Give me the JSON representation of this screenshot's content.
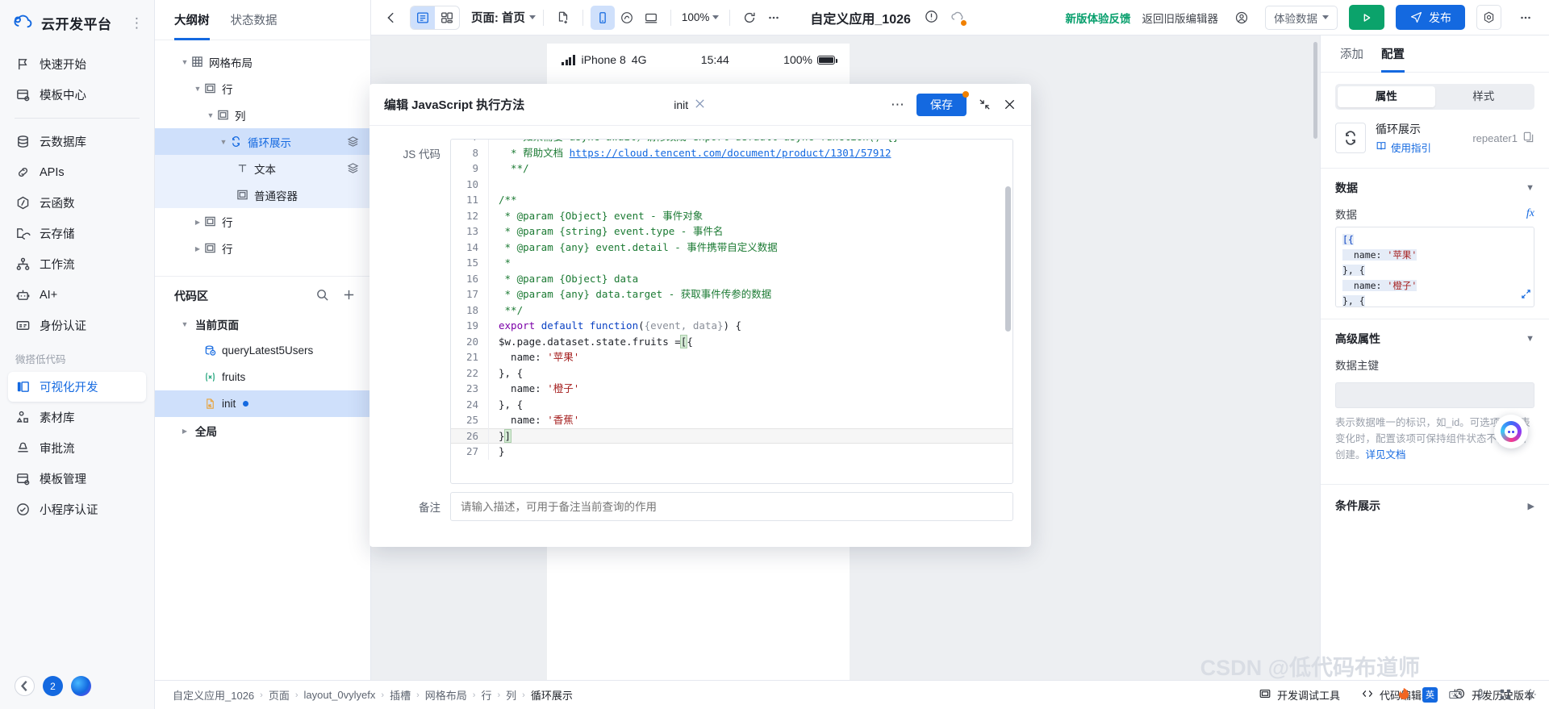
{
  "brand": {
    "name": "云开发平台",
    "logo_icon": "cloud-logo-icon",
    "more_icon": "more-vertical-icon"
  },
  "sidebar": {
    "items": [
      {
        "label": "快速开始",
        "icon": "flag-icon"
      },
      {
        "label": "模板中心",
        "icon": "template-icon"
      },
      {
        "label": "云数据库",
        "icon": "database-icon"
      },
      {
        "label": "APIs",
        "icon": "link-icon"
      },
      {
        "label": "云函数",
        "icon": "function-icon"
      },
      {
        "label": "云存储",
        "icon": "storage-icon"
      },
      {
        "label": "工作流",
        "icon": "workflow-icon"
      },
      {
        "label": "AI+",
        "icon": "robot-icon"
      },
      {
        "label": "身份认证",
        "icon": "id-card-icon"
      }
    ],
    "group_title": "微搭低代码",
    "lowcode_items": [
      {
        "label": "可视化开发",
        "icon": "layout-icon",
        "active": true
      },
      {
        "label": "素材库",
        "icon": "assets-icon",
        "active": false
      },
      {
        "label": "审批流",
        "icon": "approval-icon",
        "active": false
      },
      {
        "label": "模板管理",
        "icon": "template-manage-icon",
        "active": false
      },
      {
        "label": "小程序认证",
        "icon": "miniprogram-icon",
        "active": false
      }
    ],
    "collapse_icon": "chevron-left-icon",
    "user_badge": "2",
    "assistant_icon": "assistant-icon"
  },
  "outline": {
    "tabs": [
      {
        "label": "大纲树",
        "active": true
      },
      {
        "label": "状态数据",
        "active": false
      }
    ],
    "tree": [
      {
        "label": "网格布局",
        "icon": "grid-icon",
        "depth": 0,
        "caret": "open",
        "state": ""
      },
      {
        "label": "行",
        "icon": "box-icon",
        "depth": 1,
        "caret": "open",
        "state": ""
      },
      {
        "label": "列",
        "icon": "box-icon",
        "depth": 2,
        "caret": "open",
        "state": ""
      },
      {
        "label": "循环展示",
        "icon": "repeat-icon",
        "depth": 3,
        "caret": "open",
        "state": "sel",
        "layers": true
      },
      {
        "label": "文本",
        "icon": "text-icon",
        "depth": 4,
        "caret": "",
        "state": "sub",
        "layers": true
      },
      {
        "label": "普通容器",
        "icon": "box-icon",
        "depth": 4,
        "caret": "",
        "state": "sub",
        "layers": false
      },
      {
        "label": "行",
        "icon": "box-icon",
        "depth": 1,
        "caret": "closed",
        "state": ""
      },
      {
        "label": "行",
        "icon": "box-icon",
        "depth": 1,
        "caret": "closed",
        "state": ""
      }
    ],
    "code_section": {
      "title": "代码区",
      "search_icon": "search-icon",
      "add_icon": "plus-icon",
      "groups": [
        {
          "label": "当前页面",
          "caret": "open"
        },
        {
          "label": "全局",
          "caret": "closed"
        }
      ],
      "files": [
        {
          "label": "queryLatest5Users",
          "icon": "datasource-icon",
          "selected": false,
          "modified": false
        },
        {
          "label": "fruits",
          "icon": "variable-icon",
          "selected": false,
          "modified": false
        },
        {
          "label": "init",
          "icon": "js-file-icon",
          "selected": true,
          "modified": true
        }
      ]
    }
  },
  "toolbar": {
    "back_icon": "arrow-left-icon",
    "view_outline_icon": "outline-view-icon",
    "view_grid_icon": "grid-view-icon",
    "page_label": "页面: 首页",
    "new_page_icon": "new-page-icon",
    "device_mobile_icon": "mobile-icon",
    "device_watch_icon": "watch-icon",
    "device_desktop_icon": "desktop-icon",
    "zoom_value": "100%",
    "refresh_icon": "refresh-icon",
    "more_icon": "more-horizontal-icon",
    "app_title": "自定义应用_1026",
    "warning_icon": "warning-circle-icon",
    "cloud_icon": "cloud-sync-icon",
    "feedback_link": "新版体验反馈",
    "old_editor_link": "返回旧版编辑器",
    "account_icon": "account-icon",
    "env_select": "体验数据",
    "preview_icon": "play-icon",
    "publish_label": "发布",
    "publish_icon": "send-icon",
    "settings_icon": "settings-icon",
    "more_right_icon": "more-horizontal-icon"
  },
  "canvas": {
    "phone": {
      "signal_icon": "signal-icon",
      "device": "iPhone 8",
      "network": "4G",
      "time": "15:44",
      "battery": "100%",
      "battery_icon": "battery-icon"
    }
  },
  "modal": {
    "title": "编辑 JavaScript 执行方法",
    "method_name": "init",
    "method_icon": "link-broken-icon",
    "more_icon": "more-horizontal-icon",
    "save_label": "保存",
    "collapse_icon": "minimize-icon",
    "close_icon": "close-icon",
    "js_label": "JS 代码",
    "remark_label": "备注",
    "remark_placeholder": "请输入描述，可用于备注当前查询的作用",
    "code_lines": [
      {
        "n": "7",
        "segs": [
          {
            "t": "  * 如果需要 async-await，请修改成 export default async function() {}",
            "c": "k-green"
          }
        ]
      },
      {
        "n": "8",
        "segs": [
          {
            "t": "  * 帮助文档 ",
            "c": "k-green"
          },
          {
            "t": "https://cloud.tencent.com/document/product/1301/57912",
            "c": "k-link"
          }
        ]
      },
      {
        "n": "9",
        "segs": [
          {
            "t": "  **/",
            "c": "k-green"
          }
        ]
      },
      {
        "n": "10",
        "segs": [
          {
            "t": "",
            "c": ""
          }
        ]
      },
      {
        "n": "11",
        "segs": [
          {
            "t": "/**",
            "c": "k-green"
          }
        ]
      },
      {
        "n": "12",
        "segs": [
          {
            "t": " * @param {Object} event - 事件对象",
            "c": "k-green"
          }
        ]
      },
      {
        "n": "13",
        "segs": [
          {
            "t": " * @param {string} event.type - 事件名",
            "c": "k-green"
          }
        ]
      },
      {
        "n": "14",
        "segs": [
          {
            "t": " * @param {any} event.detail - 事件携带自定义数据",
            "c": "k-green"
          }
        ]
      },
      {
        "n": "15",
        "segs": [
          {
            "t": " *",
            "c": "k-green"
          }
        ]
      },
      {
        "n": "16",
        "segs": [
          {
            "t": " * @param {Object} data",
            "c": "k-green"
          }
        ]
      },
      {
        "n": "17",
        "segs": [
          {
            "t": " * @param {any} data.target - 获取事件传参的数据",
            "c": "k-green"
          }
        ]
      },
      {
        "n": "18",
        "segs": [
          {
            "t": " **/",
            "c": "k-green"
          }
        ]
      },
      {
        "n": "19",
        "segs": [
          {
            "t": "export",
            "c": "k-purple"
          },
          {
            "t": " ",
            "c": ""
          },
          {
            "t": "default",
            "c": "k-blue"
          },
          {
            "t": " ",
            "c": ""
          },
          {
            "t": "function",
            "c": "k-blue"
          },
          {
            "t": "(",
            "c": "k-dark"
          },
          {
            "t": "{event, data}",
            "c": "k-grey"
          },
          {
            "t": ") {",
            "c": "k-dark"
          }
        ]
      },
      {
        "n": "20",
        "segs": [
          {
            "t": "$w.page.dataset.state.fruits =",
            "c": "k-dark"
          },
          {
            "t": "[",
            "c": "sel-box"
          },
          {
            "t": "{",
            "c": "k-dark"
          }
        ]
      },
      {
        "n": "21",
        "segs": [
          {
            "t": "  name: ",
            "c": "k-dark"
          },
          {
            "t": "'苹果'",
            "c": "k-red"
          }
        ]
      },
      {
        "n": "22",
        "segs": [
          {
            "t": "}, {",
            "c": "k-dark"
          }
        ]
      },
      {
        "n": "23",
        "segs": [
          {
            "t": "  name: ",
            "c": "k-dark"
          },
          {
            "t": "'橙子'",
            "c": "k-red"
          }
        ]
      },
      {
        "n": "24",
        "segs": [
          {
            "t": "}, {",
            "c": "k-dark"
          }
        ]
      },
      {
        "n": "25",
        "segs": [
          {
            "t": "  name: ",
            "c": "k-dark"
          },
          {
            "t": "'香蕉'",
            "c": "k-red"
          }
        ]
      },
      {
        "n": "26",
        "segs": [
          {
            "t": "}",
            "c": "k-dark"
          },
          {
            "t": "]",
            "c": "sel-box"
          }
        ],
        "current": true
      },
      {
        "n": "27",
        "segs": [
          {
            "t": "}",
            "c": "k-dark"
          }
        ]
      }
    ]
  },
  "right_panel": {
    "tabs": [
      {
        "label": "添加",
        "active": false
      },
      {
        "label": "配置",
        "active": true
      }
    ],
    "segments": [
      {
        "label": "属性",
        "on": true
      },
      {
        "label": "样式",
        "on": false
      }
    ],
    "component": {
      "icon": "repeat-icon",
      "name": "循环展示",
      "guide_label": "使用指引",
      "guide_icon": "book-icon",
      "id": "repeater1",
      "copy_icon": "copy-icon"
    },
    "data_section": {
      "title": "数据",
      "collapse_icon": "chevron-down-icon",
      "field_label": "数据",
      "fx_icon": "fx-icon",
      "code": [
        "[{",
        "  name: '苹果'",
        "}, {",
        "  name: '橙子'",
        "}, {"
      ],
      "expand_icon": "expand-icon"
    },
    "advanced_section": {
      "title": "高级属性",
      "collapse_icon": "chevron-down-icon",
      "field_label": "数据主键",
      "field_value": "",
      "help_text": "表示数据唯一的标识，如_id。可选项，列表变化时，配置该项可保持组件状态不被重新创建。",
      "help_link": "详见文档"
    },
    "condition_section": {
      "title": "条件展示",
      "arrow_icon": "chevron-right-icon"
    },
    "fab_icon": "assistant-fab-icon"
  },
  "bottom_bar": {
    "breadcrumb": [
      "自定义应用_1026",
      "页面",
      "layout_0vylyefx",
      "插槽",
      "网格布局",
      "行",
      "列",
      "循环展示"
    ],
    "actions": [
      {
        "label": "开发调试工具",
        "icon": "debug-icon"
      },
      {
        "label": "代码编辑器",
        "icon": "code-icon"
      },
      {
        "label": "开发历史版本",
        "icon": "history-icon"
      }
    ],
    "watermark": "CSDN @低代码布道师"
  },
  "colors": {
    "accent": "#1469e0",
    "green": "#0ba36b",
    "orange": "#f08000",
    "selection": "#cfe0fb"
  }
}
